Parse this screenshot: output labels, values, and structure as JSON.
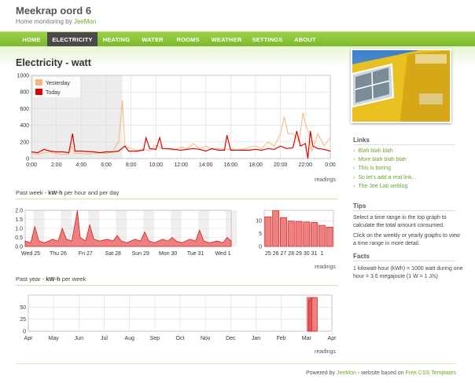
{
  "site": {
    "title": "Meekrap oord 6",
    "subtitle_prefix": "Home monitoring by ",
    "subtitle_link": "JeeMon"
  },
  "nav": {
    "items": [
      {
        "label": "HOME",
        "active": false
      },
      {
        "label": "ELECTRICITY",
        "active": true
      },
      {
        "label": "HEATING",
        "active": false
      },
      {
        "label": "WATER",
        "active": false
      },
      {
        "label": "ROOMS",
        "active": false
      },
      {
        "label": "WEATHER",
        "active": false
      },
      {
        "label": "SETTINGS",
        "active": false
      },
      {
        "label": "ABOUT",
        "active": false
      }
    ]
  },
  "main": {
    "title": "Electricity - watt",
    "readings_label": "readings",
    "week_heading_pre": "Past week - ",
    "week_heading_bold": "kW·h",
    "week_heading_post": " per hour and per day",
    "year_heading_pre": "Past year - ",
    "year_heading_bold": "kW·h",
    "year_heading_post": " per week"
  },
  "sidebar": {
    "links_title": "Links",
    "links": [
      "Blah blah blah",
      "More blah blah blah",
      "This is boring",
      "So let's add a real link...",
      "The Jee Lab weblog"
    ],
    "tips_title": "Tips",
    "tips": [
      "Select a time range in the top graph to calculate the total amount consumed.",
      "Click on the weekly or yearly graphs to view a time range in more detail."
    ],
    "facts_title": "Facts",
    "facts": "1 kilowatt-hour (kWh) = 1000 watt during one hour = 3.6 megajoule (1 W = 1 J/s)"
  },
  "footer": {
    "pre": "Powered by ",
    "link1": "JeeMon",
    "mid": " - website based on ",
    "link2": "Free CSS Templates"
  },
  "colors": {
    "accent": "#7cb82a",
    "nav_active": "#4a4a4a",
    "today": "#e00000",
    "yesterday": "#f5b87a",
    "bars": "#f08080"
  },
  "chart_data": [
    {
      "type": "line",
      "title": "",
      "x_ticks": [
        "0:00",
        "2:00",
        "4:00",
        "6:00",
        "8:00",
        "10:00",
        "12:00",
        "14:00",
        "16:00",
        "18:00",
        "20:00",
        "22:00",
        "0:00"
      ],
      "y_ticks": [
        "0",
        "200",
        "400",
        "600",
        "800",
        "1000"
      ],
      "ylim": [
        0,
        1000
      ],
      "xlim": [
        0,
        24
      ],
      "grid": true,
      "legend": "top-left",
      "shaded_range_hours": [
        0,
        7.3
      ],
      "series": [
        {
          "name": "Yesterday",
          "x": [
            0,
            0.5,
            1,
            1.5,
            2,
            2.5,
            3,
            3.2,
            3.5,
            4,
            4.5,
            5,
            5.5,
            6,
            6.5,
            7,
            7.3,
            7.5,
            8,
            8.5,
            9,
            9.5,
            10,
            10.5,
            11,
            11.5,
            12,
            12.5,
            13,
            13.5,
            14,
            14.5,
            15,
            15.5,
            16,
            16.5,
            17,
            17.5,
            18,
            18.5,
            19,
            19.5,
            20,
            20.3,
            20.6,
            21,
            21.5,
            21.8,
            22,
            22.3,
            22.5,
            23,
            23.5,
            24
          ],
          "y": [
            60,
            50,
            70,
            80,
            60,
            50,
            50,
            150,
            60,
            60,
            55,
            60,
            70,
            60,
            80,
            200,
            700,
            150,
            120,
            100,
            110,
            90,
            160,
            120,
            110,
            100,
            140,
            120,
            180,
            120,
            150,
            110,
            120,
            110,
            110,
            100,
            110,
            140,
            150,
            120,
            200,
            150,
            300,
            500,
            300,
            300,
            200,
            550,
            420,
            300,
            80,
            300,
            150,
            250
          ]
        },
        {
          "name": "Today",
          "x": [
            0,
            0.5,
            1,
            1.5,
            2,
            2.5,
            3,
            3.3,
            3.5,
            4,
            4.5,
            5,
            5.5,
            6,
            6.5,
            7,
            7.5,
            7.8,
            8,
            8.5,
            9,
            9.2,
            9.5,
            10,
            10.3,
            10.5,
            11,
            11.5,
            12,
            12.5,
            13,
            13.5,
            14,
            14.5,
            15,
            15.5,
            15.7,
            16,
            16.5,
            17,
            17.5,
            18,
            18.5,
            19,
            19.5,
            20,
            20.5,
            21,
            21.3,
            21.6,
            22,
            22.2,
            22.4,
            22.6,
            23,
            23.5,
            24
          ],
          "y": [
            80,
            70,
            110,
            90,
            80,
            80,
            70,
            300,
            90,
            90,
            85,
            80,
            70,
            80,
            80,
            90,
            150,
            90,
            90,
            90,
            100,
            250,
            120,
            110,
            250,
            120,
            120,
            110,
            100,
            110,
            120,
            110,
            90,
            120,
            100,
            100,
            280,
            100,
            100,
            100,
            100,
            110,
            100,
            120,
            110,
            150,
            120,
            130,
            330,
            150,
            180,
            0,
            330,
            150,
            120,
            110,
            90
          ]
        }
      ]
    },
    {
      "type": "area",
      "title": "",
      "x_ticks": [
        "Wed 25",
        "Thu 26",
        "Fri 27",
        "Sat 28",
        "Sun 29",
        "Mon 30",
        "Tue 31",
        "Wed 1"
      ],
      "y_ticks": [
        "0.0",
        "0.5",
        "1.0",
        "1.5",
        "2.0"
      ],
      "ylim": [
        0,
        2.0
      ],
      "xlim": [
        0,
        7.5
      ],
      "grid": true,
      "series": [
        {
          "name": "",
          "x": [
            0,
            0.2,
            0.35,
            0.5,
            0.7,
            1.0,
            1.2,
            1.35,
            1.5,
            1.7,
            1.9,
            2.0,
            2.2,
            2.35,
            2.5,
            2.7,
            3.0,
            3.2,
            3.35,
            3.5,
            3.7,
            4.0,
            4.2,
            4.35,
            4.5,
            4.7,
            5.0,
            5.2,
            5.35,
            5.5,
            5.7,
            6.0,
            6.2,
            6.35,
            6.5,
            6.7,
            7.0,
            7.2,
            7.35,
            7.5
          ],
          "y": [
            0.3,
            0.2,
            1.1,
            0.3,
            0.2,
            0.4,
            0.3,
            1.0,
            0.4,
            0.3,
            2.0,
            0.5,
            0.3,
            1.2,
            0.4,
            0.3,
            0.4,
            0.3,
            0.6,
            0.3,
            0.2,
            0.4,
            0.3,
            0.8,
            0.3,
            0.2,
            0.4,
            0.3,
            0.5,
            0.3,
            0.2,
            0.4,
            0.3,
            0.9,
            0.3,
            0.2,
            0.3,
            0.2,
            0.5,
            0.3
          ]
        }
      ]
    },
    {
      "type": "bar",
      "title": "",
      "categories": [
        "25",
        "26",
        "27",
        "28",
        "29",
        "30",
        "31",
        "1"
      ],
      "values": [
        11.5,
        13.8,
        11.2,
        9.8,
        9.7,
        9.5,
        9.3,
        8.2,
        7.5
      ],
      "y_ticks": [
        "0",
        "5",
        "10"
      ],
      "ylim": [
        0,
        14
      ],
      "grid": true
    },
    {
      "type": "bar",
      "title": "",
      "x_ticks": [
        "Apr",
        "May",
        "Jun",
        "Jul",
        "Aug",
        "Sep",
        "Oct",
        "Nov",
        "Dec",
        "Jan",
        "Feb",
        "Mar",
        "Apr"
      ],
      "y_ticks": [
        "0",
        "25",
        "50"
      ],
      "ylim": [
        0,
        75
      ],
      "grid": true,
      "values_weeks": [
        47.8,
        48.0,
        48.2,
        48.4,
        48.6
      ],
      "values": [
        70,
        65,
        63,
        68,
        70
      ]
    }
  ]
}
